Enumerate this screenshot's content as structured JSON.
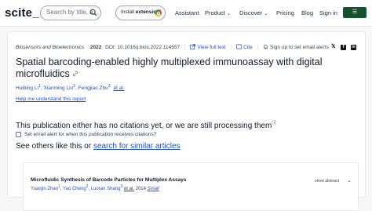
{
  "header": {
    "logo": "scite_",
    "search_placeholder": "Search by title, a...",
    "extension_button": {
      "prefix": "Install ",
      "bold": "extension!"
    },
    "nav": {
      "assistant": "Assistant",
      "product": "Product",
      "discover": "Discover",
      "pricing": "Pricing",
      "blog": "Blog",
      "signin": "Sign in"
    }
  },
  "publication": {
    "journal": "Biosensors and Bioelectronics",
    "year": "2022",
    "doi": "DOI: 10.1016/j.bios.2022.114557",
    "view_full_text": "View full text",
    "cite": "Cite",
    "sign_up_alerts": "Sign up to set email alerts",
    "title": "Spatial barcoding-enabled highly multiplexed immunoassay with digital microfluidics",
    "authors": [
      {
        "name": "Huibing Li",
        "sup": "1"
      },
      {
        "name": "Xianming Liu",
        "sup": "2"
      },
      {
        "name": "Fengjiao Zhu",
        "sup": "3"
      }
    ],
    "et_al": "et al.",
    "help_link": "Help me understand this report"
  },
  "citations": {
    "notice": "This publication either has no citations yet, or we are still processing them",
    "alert_label": "Set email alert for when this publication receives citations?",
    "see_others_prefix": "See others like this or ",
    "see_others_link": "search for similar articles"
  },
  "related": [
    {
      "title": "Microfluidic Synthesis of Barcode Particles for Multiplex Assays",
      "authors": [
        {
          "name": "Yuanjin Zhao",
          "sup": "1"
        },
        {
          "name": "Yao Cheng",
          "sup": "2"
        },
        {
          "name": "Luoran Shang",
          "sup": "3"
        }
      ],
      "et_al": "et al.",
      "year": "2014",
      "journal": "Small",
      "show_abstract": "show abstract"
    }
  ],
  "colors": {
    "accent_link": "#1d4ed8",
    "signin_bg": "#14532d"
  }
}
